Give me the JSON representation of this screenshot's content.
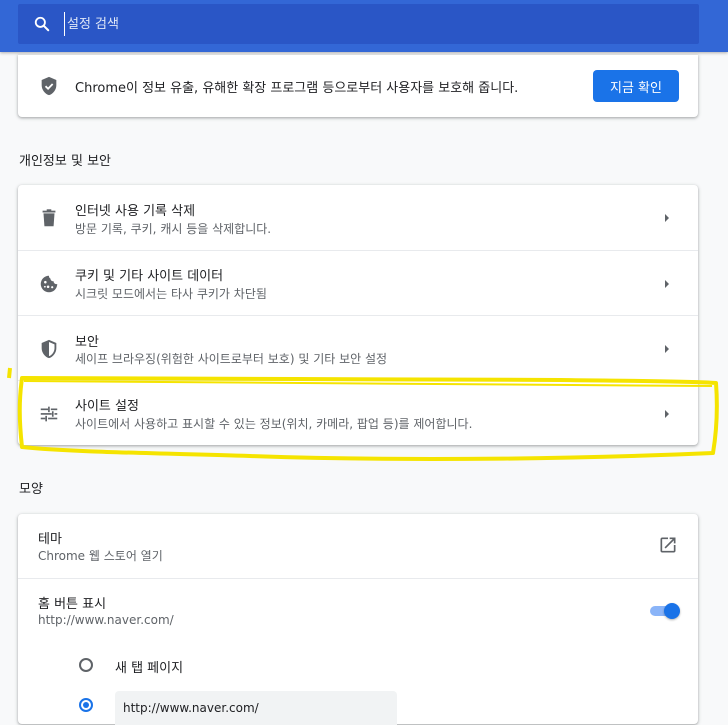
{
  "search": {
    "placeholder": "설정 검색"
  },
  "safety_banner": {
    "text": "Chrome이 정보 유출, 유해한 확장 프로그램 등으로부터 사용자를 보호해 줍니다.",
    "button": "지금 확인"
  },
  "privacy": {
    "title": "개인정보 및 보안",
    "items": [
      {
        "title": "인터넷 사용 기록 삭제",
        "subtitle": "방문 기록, 쿠키, 캐시 등을 삭제합니다.",
        "icon": "trash-icon"
      },
      {
        "title": "쿠키 및 기타 사이트 데이터",
        "subtitle": "시크릿 모드에서는 타사 쿠키가 차단됨",
        "icon": "cookie-icon"
      },
      {
        "title": "보안",
        "subtitle": "세이프 브라우징(위험한 사이트로부터 보호) 및 기타 보안 설정",
        "icon": "shield-icon"
      },
      {
        "title": "사이트 설정",
        "subtitle": "사이트에서 사용하고 표시할 수 있는 정보(위치, 카메라, 팝업 등)를 제어합니다.",
        "icon": "tune-icon"
      }
    ]
  },
  "appearance": {
    "title": "모양",
    "theme": {
      "title": "테마",
      "subtitle": "Chrome 웹 스토어 열기"
    },
    "home_button": {
      "title": "홈 버튼 표시",
      "subtitle": "http://www.naver.com/",
      "enabled": true
    },
    "home_options": [
      {
        "label": "새 탭 페이지",
        "checked": false
      },
      {
        "label": "http://www.naver.com/",
        "checked": true
      }
    ]
  },
  "colors": {
    "topbar": "#3367d6",
    "accent": "#1a73e8",
    "highlight": "#f5e400"
  }
}
